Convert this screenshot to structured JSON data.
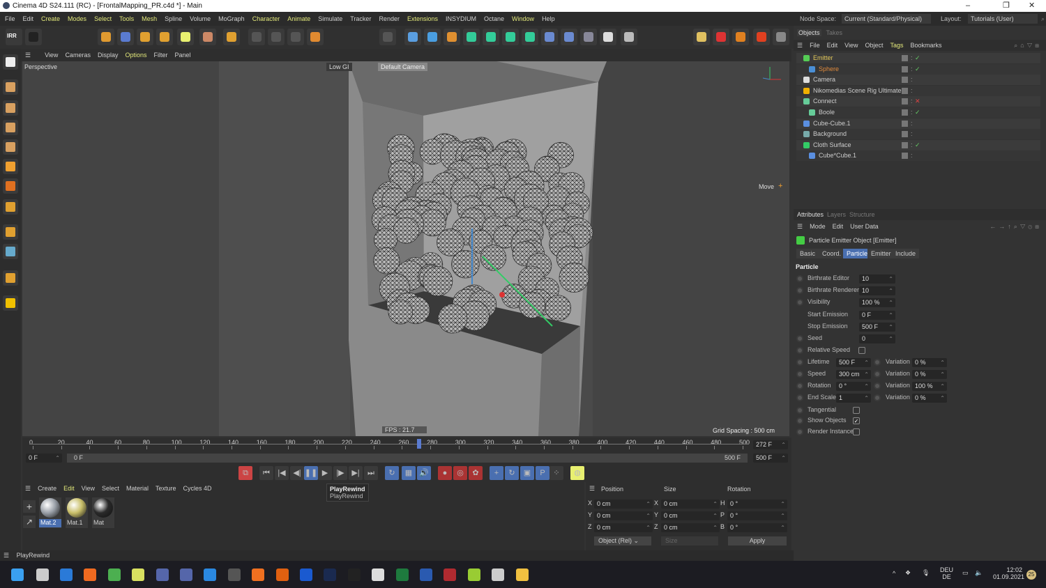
{
  "window": {
    "title": "Cinema 4D S24.111 (RC) - [FrontalMapping_PR.c4d *] - Main",
    "minimize": "–",
    "maximize": "❐",
    "close": "✕"
  },
  "menu": {
    "items": [
      {
        "label": "File"
      },
      {
        "label": "Edit"
      },
      {
        "label": "Create",
        "hl": true
      },
      {
        "label": "Modes",
        "hl": true
      },
      {
        "label": "Select",
        "hl": true
      },
      {
        "label": "Tools",
        "hl": true
      },
      {
        "label": "Mesh",
        "hl": true
      },
      {
        "label": "Spline"
      },
      {
        "label": "Volume"
      },
      {
        "label": "MoGraph"
      },
      {
        "label": "Character",
        "hl": true
      },
      {
        "label": "Animate",
        "hl": true
      },
      {
        "label": "Simulate"
      },
      {
        "label": "Tracker"
      },
      {
        "label": "Render"
      },
      {
        "label": "Extensions",
        "hl": true
      },
      {
        "label": "INSYDIUM"
      },
      {
        "label": "Octane"
      },
      {
        "label": "Window",
        "hl": true
      },
      {
        "label": "Help"
      }
    ],
    "node_space_label": "Node Space:",
    "node_space_value": "Current (Standard/Physical)",
    "layout_label": "Layout:",
    "layout_value": "Tutorials (User)"
  },
  "toolbar": {
    "irr_label": "IRR",
    "icons": [
      "irr-render-icon",
      "render-settings-icon",
      "select-icon",
      "move-icon",
      "rotate-icon",
      "scale-icon",
      "live-select-icon",
      "transform-icon",
      "axis-icon",
      "x-axis-icon",
      "y-axis-icon",
      "z-axis-icon",
      "coordinate-system-icon",
      "render-region-icon",
      "render-view-icon",
      "cube-icon",
      "pen-icon",
      "subdivide-icon",
      "extrude-icon",
      "cloner-icon",
      "array-icon",
      "spline-icon",
      "deformer-icon",
      "floor-icon",
      "camera-icon",
      "light-icon",
      "nikomedias-icon",
      "no-icon",
      "xparticles-icon",
      "xparticles-2-icon",
      "layout-icon"
    ]
  },
  "viewport": {
    "menu": [
      "View",
      "Cameras",
      "Display",
      "Options",
      "Filter",
      "Panel"
    ],
    "menu_hl": 3,
    "label": "Perspective",
    "gi": "Low GI",
    "camera": "Default Camera",
    "tool": "Move",
    "fps": "FPS : 21.7",
    "grid": "Grid Spacing : 500 cm"
  },
  "timeline": {
    "ticks": [
      "0",
      "20",
      "40",
      "60",
      "80",
      "100",
      "120",
      "140",
      "160",
      "180",
      "200",
      "220",
      "240",
      "260",
      "280",
      "300",
      "320",
      "340",
      "360",
      "380",
      "400",
      "420",
      "440",
      "460",
      "480",
      "500"
    ],
    "current_frame": 272,
    "current_label": "272 F",
    "start": "0 F",
    "range_start": "0 F",
    "range_end": "500 F",
    "end": "500 F",
    "max": 500
  },
  "playback": {
    "tooltip_title": "PlayRewind",
    "tooltip_sub": "PlayRewind"
  },
  "materials": {
    "menu": [
      "Create",
      "Edit",
      "View",
      "Select",
      "Material",
      "Texture",
      "Cycles 4D"
    ],
    "menu_hl": 1,
    "items": [
      {
        "name": "Mat.2",
        "color": "#9aa0a8"
      },
      {
        "name": "Mat.1",
        "color": "#c9bf6a"
      },
      {
        "name": "Mat",
        "color": "#2a2a2a"
      }
    ]
  },
  "coords": {
    "headers": [
      "Position",
      "Size",
      "Rotation"
    ],
    "rows": [
      {
        "a": "X",
        "p": "0 cm",
        "b": "X",
        "s": "0 cm",
        "c": "H",
        "r": "0 °"
      },
      {
        "a": "Y",
        "p": "0 cm",
        "b": "Y",
        "s": "0 cm",
        "c": "P",
        "r": "0 °"
      },
      {
        "a": "Z",
        "p": "0 cm",
        "b": "Z",
        "s": "0 cm",
        "c": "B",
        "r": "0 °"
      }
    ],
    "mode": "Object (Rel)",
    "size_mode": "Size",
    "apply": "Apply"
  },
  "status": "PlayRewind",
  "objects": {
    "tabs": [
      "Objects",
      "Takes"
    ],
    "menu": [
      "File",
      "Edit",
      "View",
      "Object",
      "Tags",
      "Bookmarks"
    ],
    "menu_hl": 4,
    "items": [
      {
        "name": "Emitter",
        "depth": 0,
        "color": "#e3c85a",
        "icon": "#5c5",
        "check": "✓"
      },
      {
        "name": "Sphere",
        "depth": 1,
        "color": "#e08a3c",
        "icon": "#4a8fd6",
        "check": "✓"
      },
      {
        "name": "Camera",
        "depth": 0,
        "color": "#ccc",
        "icon": "#ddd",
        "check": ""
      },
      {
        "name": "Nikomedias Scene Rig Ultimate",
        "depth": 0,
        "color": "#ccc",
        "icon": "#f0b000",
        "check": ""
      },
      {
        "name": "Connect",
        "depth": 0,
        "color": "#ccc",
        "icon": "#6c9",
        "check": "✕"
      },
      {
        "name": "Boole",
        "depth": 1,
        "color": "#ccc",
        "icon": "#6c9",
        "check": "✓"
      },
      {
        "name": "Cube-Cube.1",
        "depth": 0,
        "color": "#ccc",
        "icon": "#5a8fe0",
        "check": ""
      },
      {
        "name": "Background",
        "depth": 0,
        "color": "#ccc",
        "icon": "#7aa",
        "check": ""
      },
      {
        "name": "Cloth Surface",
        "depth": 0,
        "color": "#ccc",
        "icon": "#3c6",
        "check": "✓"
      },
      {
        "name": "Cube*Cube.1",
        "depth": 1,
        "color": "#ccc",
        "icon": "#5a8fe0",
        "check": ""
      }
    ]
  },
  "attributes": {
    "tabs": [
      "Attributes",
      "Layers",
      "Structure"
    ],
    "menu": [
      "Mode",
      "Edit",
      "User Data"
    ],
    "title": "Particle Emitter Object [Emitter]",
    "subtabs": [
      "Basic",
      "Coord.",
      "Particle",
      "Emitter",
      "Include"
    ],
    "active_subtab": 2,
    "section": "Particle",
    "fields": [
      {
        "label": "Birthrate Editor",
        "value": "10",
        "radio": true
      },
      {
        "label": "Birthrate Renderer",
        "value": "10",
        "radio": true
      },
      {
        "label": "Visibility",
        "value": "100 %",
        "radio": true
      },
      {
        "label": "Start Emission",
        "value": "0 F",
        "radio": false
      },
      {
        "label": "Stop Emission",
        "value": "500 F",
        "radio": false
      },
      {
        "label": "Seed",
        "value": "0",
        "radio": true
      }
    ],
    "relative_speed": {
      "label": "Relative Speed",
      "checked": false
    },
    "pairs": [
      {
        "label": "Lifetime",
        "value": "500 F",
        "var_label": "Variation",
        "var": "0 %"
      },
      {
        "label": "Speed",
        "value": "300 cm",
        "var_label": "Variation",
        "var": "0 %"
      },
      {
        "label": "Rotation",
        "value": "0 °",
        "var_label": "Variation",
        "var": "100 %"
      },
      {
        "label": "End Scale",
        "value": "1",
        "var_label": "Variation",
        "var": "0 %"
      }
    ],
    "checks": [
      {
        "label": "Tangential",
        "checked": false
      },
      {
        "label": "Show Objects",
        "checked": true
      },
      {
        "label": "Render Instance",
        "checked": false
      }
    ]
  },
  "taskbar": {
    "apps": [
      {
        "name": "windows-start-icon",
        "c": "#3aa0f0"
      },
      {
        "name": "task-view-icon",
        "c": "#ccc"
      },
      {
        "name": "app-blue-icon",
        "c": "#2a7ad8"
      },
      {
        "name": "firefox-icon",
        "c": "#f06a20"
      },
      {
        "name": "chrome-icon",
        "c": "#4caf50"
      },
      {
        "name": "s-app-icon",
        "c": "#d8e060"
      },
      {
        "name": "cinema4d-icon",
        "c": "#5566aa"
      },
      {
        "name": "cinema4d-2-icon",
        "c": "#5566aa"
      },
      {
        "name": "app-b-icon",
        "c": "#2a88e0"
      },
      {
        "name": "davinci-icon",
        "c": "#555"
      },
      {
        "name": "houdini-icon",
        "c": "#f07020"
      },
      {
        "name": "g-app-icon",
        "c": "#e06010"
      },
      {
        "name": "play-app-icon",
        "c": "#1a5ad0"
      },
      {
        "name": "photoshop-icon",
        "c": "#1a2a50"
      },
      {
        "name": "bridge-icon",
        "c": "#222"
      },
      {
        "name": "app-circle-icon",
        "c": "#ddd"
      },
      {
        "name": "excel-icon",
        "c": "#1e7a3e"
      },
      {
        "name": "word-icon",
        "c": "#2a5ab0"
      },
      {
        "name": "access-icon",
        "c": "#b02a30"
      },
      {
        "name": "app-green-icon",
        "c": "#9c3"
      },
      {
        "name": "obs-icon",
        "c": "#ccc"
      },
      {
        "name": "explorer-icon",
        "c": "#f0c040"
      }
    ],
    "lang1": "DEU",
    "lang2": "DE",
    "time": "12:02",
    "date": "01.09.2021",
    "badge": "25"
  }
}
